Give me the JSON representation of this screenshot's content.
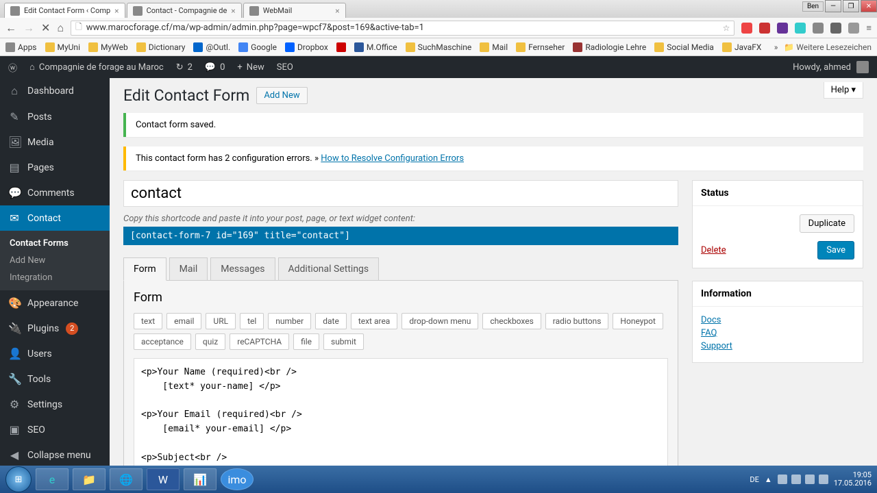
{
  "browser": {
    "tabs": [
      {
        "title": "Edit Contact Form ‹ Comp"
      },
      {
        "title": "Contact - Compagnie de"
      },
      {
        "title": "WebMail"
      }
    ],
    "win_user": "Ben",
    "url": "www.marocforage.cf/ma/wp-admin/admin.php?page=wpcf7&post=169&active-tab=1",
    "bookmarks": [
      "Apps",
      "MyUni",
      "MyWeb",
      "Dictionary",
      "@Outl.",
      "Google",
      "Dropbox",
      "M.Office",
      "SuchMaschine",
      "Mail",
      "Fernseher",
      "Radiologie Lehre",
      "Social Media",
      "JavaFX"
    ],
    "bookmarks_more": "Weitere Lesezeichen"
  },
  "adminbar": {
    "site": "Compagnie de forage au Maroc",
    "updates": "2",
    "comments": "0",
    "new": "New",
    "seo": "SEO",
    "howdy": "Howdy, ahmed"
  },
  "sidebar": {
    "items": [
      {
        "icon": "⌂",
        "label": "Dashboard"
      },
      {
        "icon": "✎",
        "label": "Posts"
      },
      {
        "icon": "🖼",
        "label": "Media"
      },
      {
        "icon": "▤",
        "label": "Pages"
      },
      {
        "icon": "💬",
        "label": "Comments"
      },
      {
        "icon": "✉",
        "label": "Contact",
        "active": true
      },
      {
        "icon": "🎨",
        "label": "Appearance"
      },
      {
        "icon": "🔌",
        "label": "Plugins",
        "badge": "2"
      },
      {
        "icon": "👤",
        "label": "Users"
      },
      {
        "icon": "🔧",
        "label": "Tools"
      },
      {
        "icon": "⚙",
        "label": "Settings"
      },
      {
        "icon": "▣",
        "label": "SEO"
      },
      {
        "icon": "◀",
        "label": "Collapse menu"
      }
    ],
    "submenu": [
      "Contact Forms",
      "Add New",
      "Integration"
    ]
  },
  "content": {
    "help": "Help ▾",
    "heading": "Edit Contact Form",
    "add_new": "Add New",
    "notice_saved": "Contact form saved.",
    "notice_errors_pre": "This contact form has 2 configuration errors. » ",
    "notice_errors_link": "How to Resolve Configuration Errors",
    "title_value": "contact",
    "shortcode_label": "Copy this shortcode and paste it into your post, page, or text widget content:",
    "shortcode": "[contact-form-7 id=\"169\" title=\"contact\"]",
    "tabs": [
      "Form",
      "Mail",
      "Messages",
      "Additional Settings"
    ],
    "panel_title": "Form",
    "tag_buttons": [
      "text",
      "email",
      "URL",
      "tel",
      "number",
      "date",
      "text area",
      "drop-down menu",
      "checkboxes",
      "radio buttons",
      "Honeypot",
      "acceptance",
      "quiz",
      "reCAPTCHA",
      "file",
      "submit"
    ],
    "form_code": "<p>Your Name (required)<br />\n    [text* your-name] </p>\n\n<p>Your Email (required)<br />\n    [email* your-email] </p>\n\n<p>Subject<br />"
  },
  "side": {
    "status_title": "Status",
    "duplicate": "Duplicate",
    "delete": "Delete",
    "save": "Save",
    "info_title": "Information",
    "links": [
      "Docs",
      "FAQ",
      "Support"
    ]
  },
  "taskbar": {
    "lang": "DE",
    "time": "19:05",
    "date": "17.05.2016"
  }
}
